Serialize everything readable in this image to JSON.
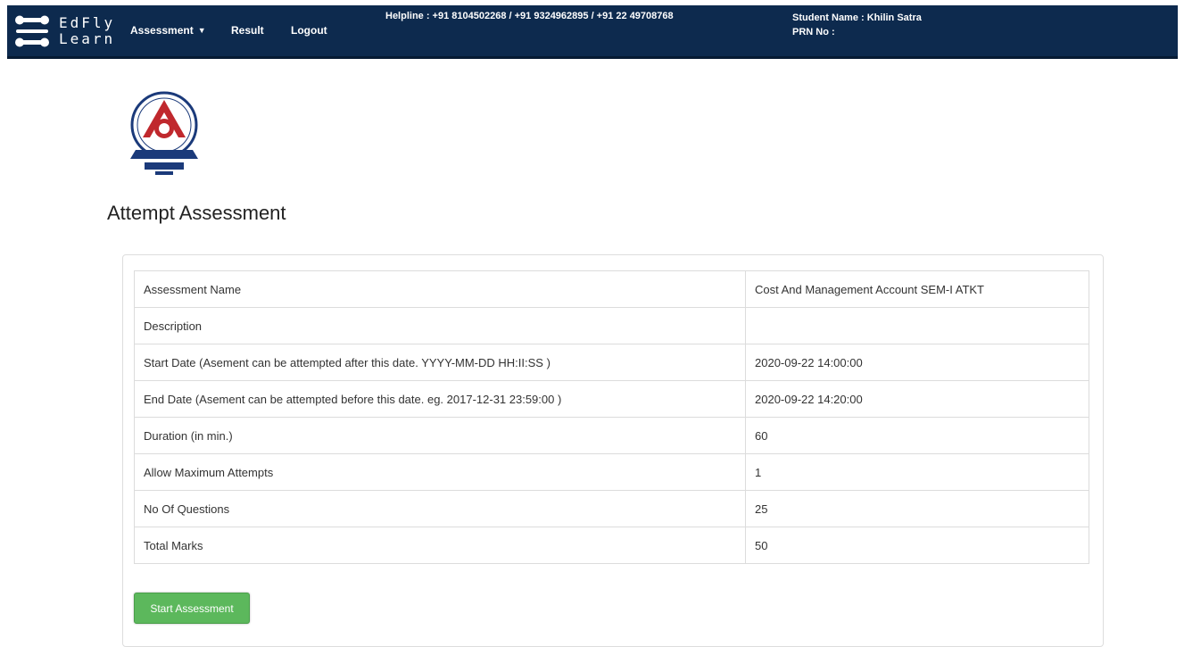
{
  "header": {
    "brand_line1": "EdFly",
    "brand_line2": "Learn",
    "nav": {
      "assessment_label": "Assessment",
      "result_label": "Result",
      "logout_label": "Logout"
    },
    "helpline": "Helpline : +91 8104502268 / +91 9324962895 / +91 22 49708768",
    "student_name": "Student Name : Khilin Satra",
    "prn": "PRN No :",
    "bg_color": "#0d2a4e"
  },
  "page": {
    "title": "Attempt Assessment"
  },
  "assessment_table": {
    "rows": [
      {
        "label": "Assessment Name",
        "value": "Cost And Management Account SEM-I ATKT"
      },
      {
        "label": "Description",
        "value": ""
      },
      {
        "label": "Start Date (Asement can be attempted after this date. YYYY-MM-DD HH:II:SS )",
        "value": "2020-09-22 14:00:00"
      },
      {
        "label": "End Date (Asement can be attempted before this date. eg. 2017-12-31 23:59:00 )",
        "value": "2020-09-22 14:20:00"
      },
      {
        "label": "Duration (in min.)",
        "value": "60"
      },
      {
        "label": "Allow Maximum Attempts",
        "value": "1"
      },
      {
        "label": "No Of Questions",
        "value": "25"
      },
      {
        "label": "Total Marks",
        "value": "50"
      }
    ]
  },
  "actions": {
    "start_label": "Start Assessment",
    "start_color": "#5cb85c"
  },
  "icons": {
    "brand": "edfly-logo-icon",
    "college": "college-emblem-icon",
    "dropdown": "caret-down-icon"
  }
}
